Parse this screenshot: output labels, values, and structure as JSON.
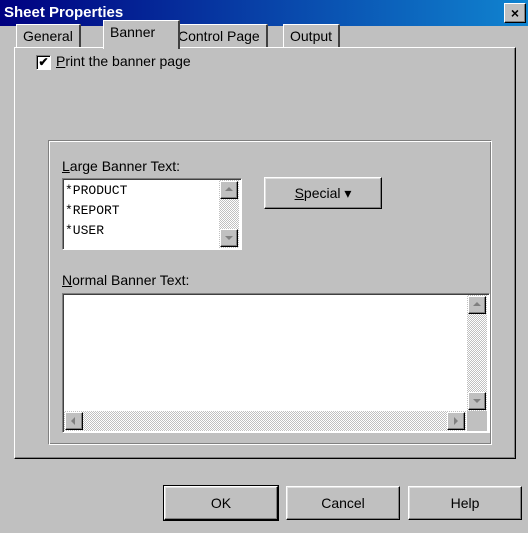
{
  "window": {
    "title": "Sheet Properties",
    "close_glyph": "×"
  },
  "tabs": [
    {
      "label": "General",
      "active": false
    },
    {
      "label": "Banner",
      "active": true
    },
    {
      "label": "Control Page",
      "active": false
    },
    {
      "label": "Output",
      "active": false
    }
  ],
  "banner": {
    "print_checkbox": {
      "checked": true,
      "check_glyph": "✔",
      "label_first": "P",
      "label_rest": "rint the banner page"
    },
    "large_text": {
      "label_first": "L",
      "label_rest": "arge Banner Text:",
      "lines": [
        "*PRODUCT",
        "*REPORT",
        "*USER"
      ]
    },
    "special_button": {
      "label_first": "S",
      "label_rest": "pecial",
      "arrow": "▾"
    },
    "normal_text": {
      "label_first": "N",
      "label_rest": "ormal Banner Text:",
      "value": ""
    }
  },
  "buttons": {
    "ok": "OK",
    "cancel": "Cancel",
    "help": "Help"
  },
  "icons": {
    "close": "close-icon",
    "check": "checkmark-icon",
    "dropdown": "dropdown-arrow-icon"
  },
  "colors": {
    "titlebar_start": "#000080",
    "titlebar_end": "#1084d0",
    "face": "#c0c0c0"
  }
}
